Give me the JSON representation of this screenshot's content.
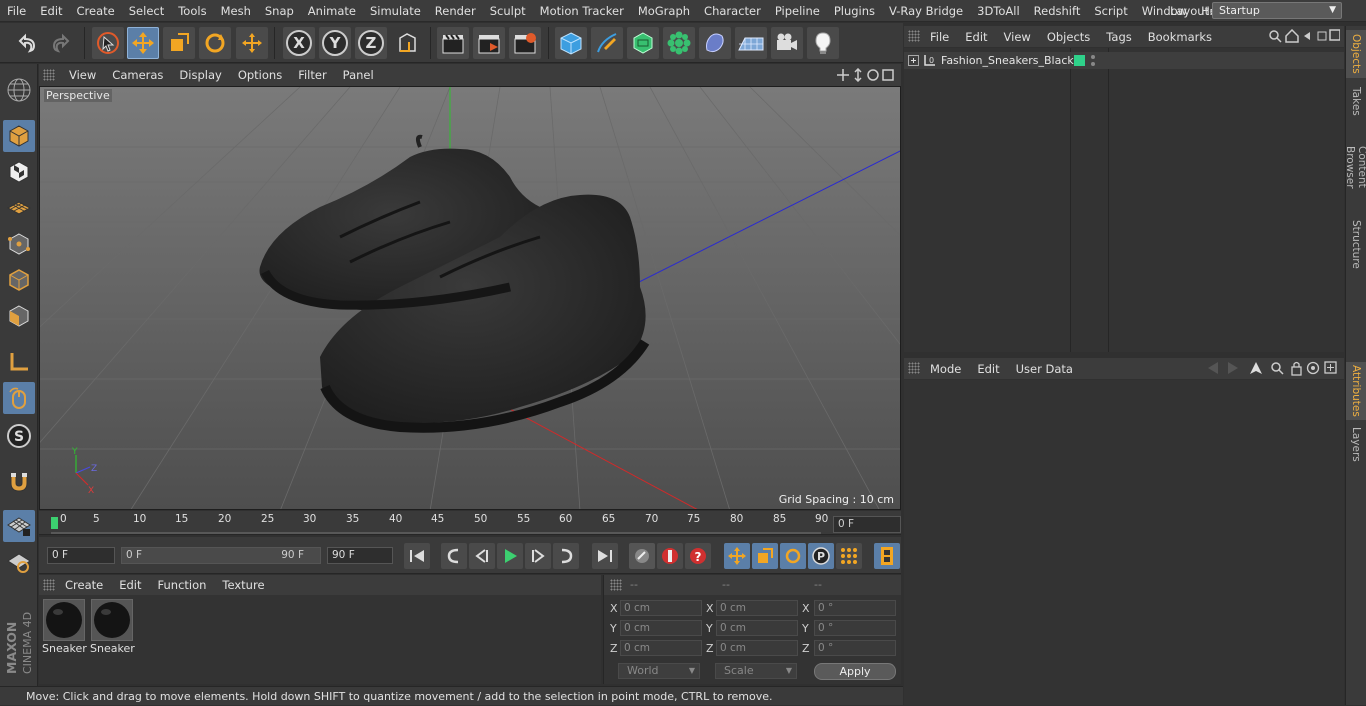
{
  "menubar": {
    "items": [
      "File",
      "Edit",
      "Create",
      "Select",
      "Tools",
      "Mesh",
      "Snap",
      "Animate",
      "Simulate",
      "Render",
      "Sculpt",
      "Motion Tracker",
      "MoGraph",
      "Character",
      "Pipeline",
      "Plugins",
      "V-Ray Bridge",
      "3DToAll",
      "Redshift",
      "Script",
      "Window",
      "Help"
    ],
    "layout_label": "Layout:",
    "layout_value": "Startup"
  },
  "viewport": {
    "menu": [
      "View",
      "Cameras",
      "Display",
      "Options",
      "Filter",
      "Panel"
    ],
    "label": "Perspective",
    "grid_spacing": "Grid Spacing : 10 cm"
  },
  "timeline": {
    "ticks": [
      "0",
      "5",
      "10",
      "15",
      "20",
      "25",
      "30",
      "35",
      "40",
      "45",
      "50",
      "55",
      "60",
      "65",
      "70",
      "75",
      "80",
      "85",
      "90"
    ],
    "current_frame": "0 F"
  },
  "transport": {
    "start": "0 F",
    "range_start": "0 F",
    "range_end": "90 F",
    "end": "90 F"
  },
  "materials": {
    "menu": [
      "Create",
      "Edit",
      "Function",
      "Texture"
    ],
    "items": [
      {
        "label": "Sneaker"
      },
      {
        "label": "Sneaker"
      }
    ]
  },
  "coords": {
    "headers": [
      "--",
      "--",
      "--"
    ],
    "rows": [
      {
        "a": "X",
        "p": "0 cm",
        "b": "X",
        "s": "0 cm",
        "c": "X",
        "r": "0 °"
      },
      {
        "a": "Y",
        "p": "0 cm",
        "b": "Y",
        "s": "0 cm",
        "c": "Y",
        "r": "0 °"
      },
      {
        "a": "Z",
        "p": "0 cm",
        "b": "Z",
        "s": "0 cm",
        "c": "Z",
        "r": "0 °"
      }
    ],
    "world": "World",
    "scale": "Scale",
    "apply": "Apply"
  },
  "status": "Move: Click and drag to move elements. Hold down SHIFT to quantize movement / add to the selection in point mode, CTRL to remove.",
  "objects": {
    "menu": [
      "File",
      "Edit",
      "View",
      "Objects",
      "Tags",
      "Bookmarks"
    ],
    "item": "Fashion_Sneakers_Black",
    "tag_color": "#2fd18a"
  },
  "attributes": {
    "menu": [
      "Mode",
      "Edit",
      "User Data"
    ]
  },
  "right_tabs": [
    "Objects",
    "Takes",
    "Content Browser",
    "Structure",
    "Attributes",
    "Layers"
  ],
  "logo": {
    "line1": "MAXON",
    "line2": "CINEMA 4D"
  }
}
